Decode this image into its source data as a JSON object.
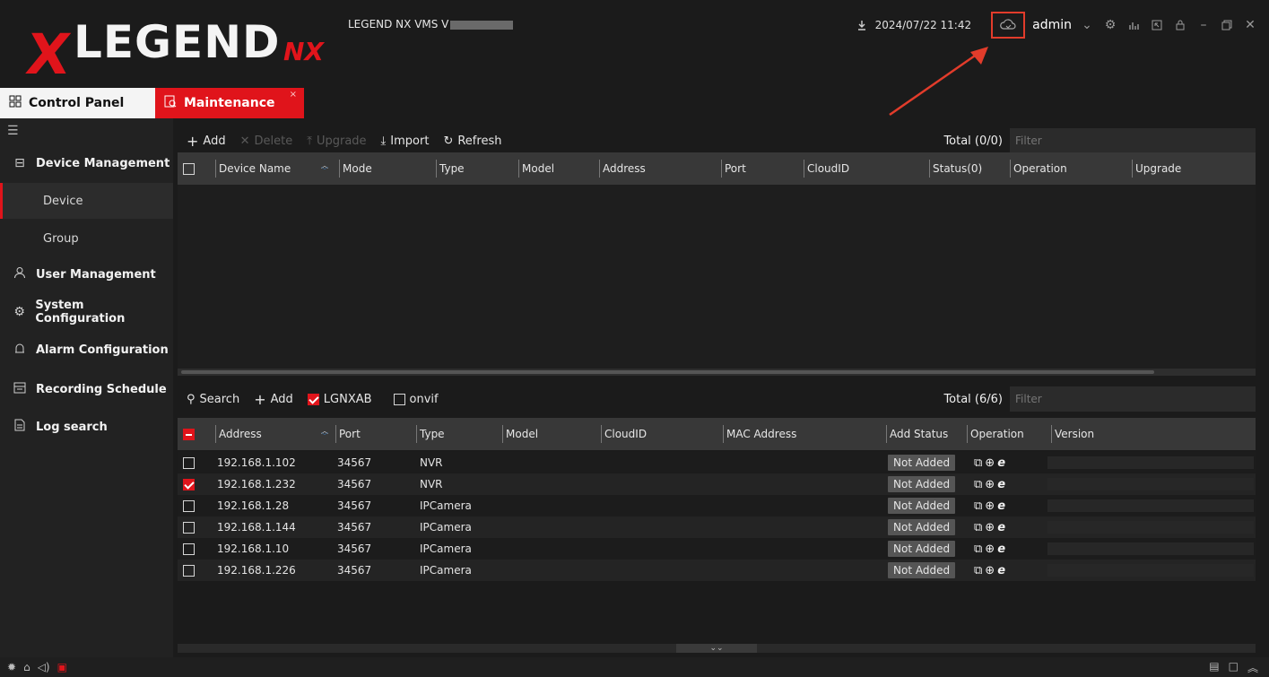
{
  "app": {
    "logo_text": "LEGEND",
    "logo_suffix": "NX",
    "logo_mark": "X",
    "version_label": "LEGEND NX VMS V",
    "datetime": "2024/07/22 11:42",
    "username": "admin",
    "accent_color": "#e0141b"
  },
  "icons": {
    "download": "download-icon",
    "cloud": "cloud-icon",
    "user_dropdown": "chevron-down-icon",
    "settings": "gear-icon",
    "stats": "bar-chart-icon",
    "screenshot": "window-icon",
    "lock": "lock-icon",
    "minimize": "minimize-icon",
    "restore": "restore-icon",
    "close": "close-icon"
  },
  "tabs": [
    {
      "label": "Control Panel",
      "icon": "grid-icon",
      "active": false
    },
    {
      "label": "Maintenance",
      "icon": "maintenance-icon",
      "active": true,
      "close": "×"
    }
  ],
  "sidebar": {
    "items": [
      {
        "label": "Device Management",
        "icon": "device-management-icon"
      },
      {
        "label": "Device",
        "sub": true,
        "selected": true
      },
      {
        "label": "Group",
        "sub": true
      },
      {
        "label": "User Management",
        "icon": "user-icon"
      },
      {
        "label": "System Configuration",
        "icon": "gear-icon"
      },
      {
        "label": "Alarm Configuration",
        "icon": "alarm-icon"
      },
      {
        "label": "Recording Schedule",
        "icon": "calendar-icon"
      },
      {
        "label": "Log search",
        "icon": "log-icon"
      }
    ]
  },
  "top_panel": {
    "toolbar": {
      "add": "Add",
      "delete": "Delete",
      "upgrade": "Upgrade",
      "import": "Import",
      "refresh": "Refresh",
      "total": "Total (0/0)",
      "filter_placeholder": "Filter"
    },
    "columns": [
      "Device Name",
      "Mode",
      "Type",
      "Model",
      "Address",
      "Port",
      "CloudID",
      "Status(0)",
      "Operation",
      "Upgrade"
    ]
  },
  "bottom_panel": {
    "toolbar": {
      "search": "Search",
      "add": "Add",
      "lgnxab": "LGNXAB",
      "lgnxab_checked": true,
      "onvif": "onvif",
      "onvif_checked": false,
      "total": "Total (6/6)",
      "filter_placeholder": "Filter"
    },
    "columns": [
      "Address",
      "Port",
      "Type",
      "Model",
      "CloudID",
      "MAC Address",
      "Add Status",
      "Operation",
      "Version"
    ],
    "rows": [
      {
        "checked": false,
        "address": "192.168.1.102",
        "port": "34567",
        "type": "NVR",
        "status": "Not Added"
      },
      {
        "checked": true,
        "address": "192.168.1.232",
        "port": "34567",
        "type": "NVR",
        "status": "Not Added"
      },
      {
        "checked": false,
        "address": "192.168.1.28",
        "port": "34567",
        "type": "IPCamera",
        "status": "Not Added"
      },
      {
        "checked": false,
        "address": "192.168.1.144",
        "port": "34567",
        "type": "IPCamera",
        "status": "Not Added"
      },
      {
        "checked": false,
        "address": "192.168.1.10",
        "port": "34567",
        "type": "IPCamera",
        "status": "Not Added"
      },
      {
        "checked": false,
        "address": "192.168.1.226",
        "port": "34567",
        "type": "IPCamera",
        "status": "Not Added"
      }
    ]
  }
}
